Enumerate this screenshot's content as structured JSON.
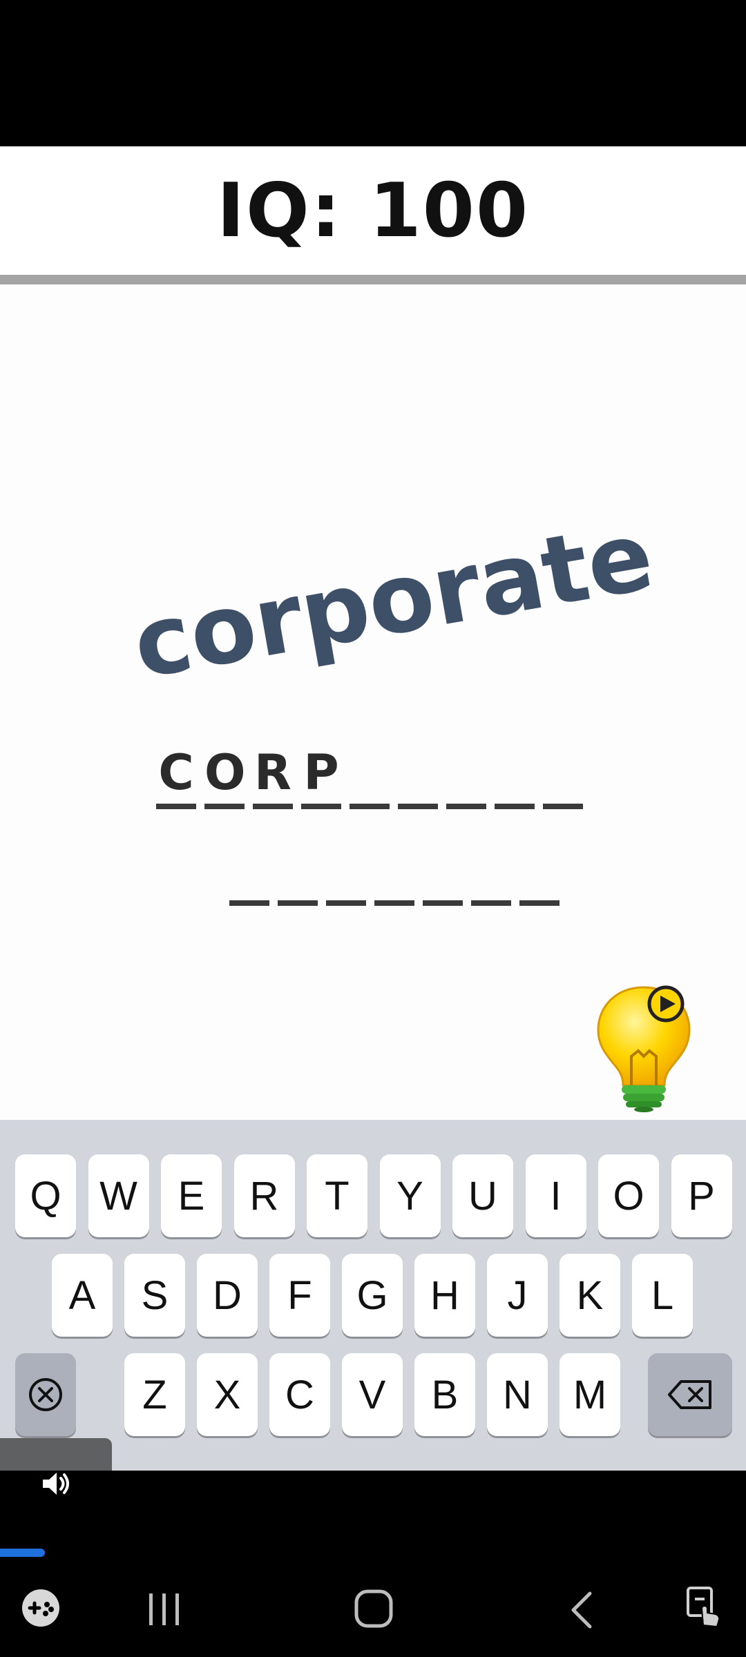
{
  "header": {
    "iq_label": "IQ: 100"
  },
  "puzzle": {
    "clue_word": "corporate",
    "answer_row1": [
      "C",
      "O",
      "R",
      "P",
      "",
      "",
      "",
      "",
      ""
    ],
    "answer_row2": [
      "",
      "",
      "",
      "",
      "",
      "",
      ""
    ]
  },
  "hint": {
    "icon": "lightbulb-play-icon"
  },
  "keyboard": {
    "row1": [
      "Q",
      "W",
      "E",
      "R",
      "T",
      "Y",
      "U",
      "I",
      "O",
      "P"
    ],
    "row2": [
      "A",
      "S",
      "D",
      "F",
      "G",
      "H",
      "J",
      "K",
      "L"
    ],
    "row3": [
      "Z",
      "X",
      "C",
      "V",
      "B",
      "N",
      "M"
    ],
    "clear_icon": "circle-x-icon",
    "backspace_icon": "backspace-icon"
  },
  "system": {
    "progress_fraction": 0.06,
    "icons": [
      "volume-icon",
      "game-launcher-icon",
      "recent-apps-icon",
      "home-icon",
      "back-icon",
      "touch-icon"
    ]
  },
  "colors": {
    "clue": "#3e5068",
    "keyboard_bg": "#d2d5db",
    "progress": "#1f6fdc"
  }
}
